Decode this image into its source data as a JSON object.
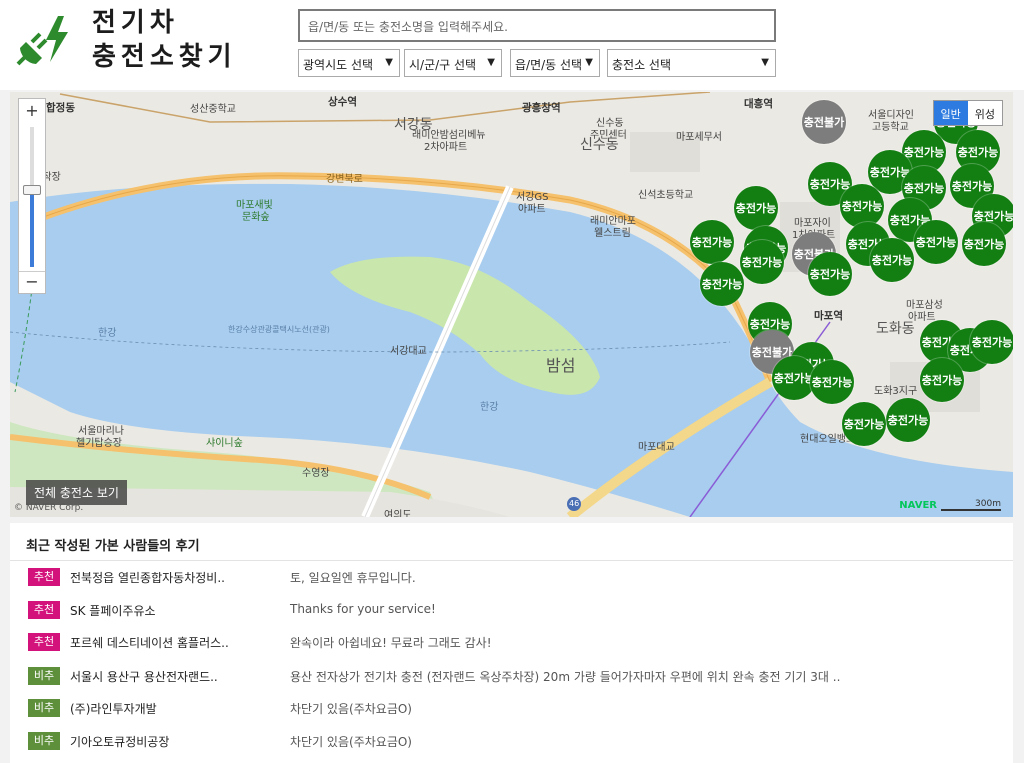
{
  "header": {
    "title_line1": "전기차",
    "title_line2": "충전소찾기",
    "search_placeholder": "읍/면/동 또는 충전소명을 입력해주세요.",
    "selects": [
      "광역시도 선택",
      "시/군/구 선택",
      "읍/면/동 선택",
      "충전소 선택"
    ],
    "select_arrow": "▼"
  },
  "map": {
    "zoom_in": "+",
    "zoom_out": "−",
    "maptype_normal": "일반",
    "maptype_satellite": "위성",
    "all_stations_button": "전체 충전소 보기",
    "copyright": "© NAVER Corp.",
    "naver_logo": "NAVER",
    "scale": "300m",
    "marker_available": "충전가능",
    "marker_unavailable": "충전불가",
    "labels": {
      "hapjeong": "합정동",
      "sangsu": "상수역",
      "gwangheung": "광흥창역",
      "daeheung": "대흥역",
      "seogang": "서강동",
      "sinsu": "신수동",
      "mapo_tax": "마포세무서",
      "seongsan_school": "성산중학교",
      "raemian1": "래미안밤섬리베뉴",
      "raemian2": "2차아파트",
      "sinsu_center1": "신수동",
      "sinsu_center2": "주민센터",
      "seogang_gs1": "서강GS",
      "seogang_gs2": "아파트",
      "raemian_mapo1": "래미안마포",
      "raemian_mapo2": "웰스트림",
      "sinseok": "신석초등학교",
      "bongsan": "봉산작장",
      "mapo_saebit1": "마포새빛",
      "mapo_saebit2": "문화숲",
      "gangbyeon": "강변북로",
      "hangang": "한강",
      "hangang2": "한강",
      "cruise": "한강수상관광콜택시노선(관광)",
      "seogang_bridge": "서강대교",
      "bamseom": "밤섬",
      "mapo_bridge": "마포대교",
      "mapo_stn": "마포역",
      "dohwa": "도화동",
      "mapo_samsung1": "마포삼성",
      "mapo_samsung2": "아파트",
      "mapo_xi1": "마포자이",
      "mapo_xi2": "1차아파트",
      "dohwa3": "도화3지구",
      "hyundai_oil": "현대오일뱅크",
      "seoul_design1": "서울디자인",
      "seoul_design2": "고등학교",
      "seoul_marina1": "서울마리나",
      "seoul_marina2": "헬기탑승장",
      "sailing": "샤이니숲",
      "pool": "수영장",
      "yeouido": "여의도",
      "num46": "46"
    }
  },
  "reviews": {
    "title": "최근 작성된 가본 사람들의 후기",
    "items": [
      {
        "badge": "추천",
        "type": "rec",
        "name": "전북정읍 열린종합자동차정비..",
        "text": "토, 일요일엔 휴무입니다."
      },
      {
        "badge": "추천",
        "type": "rec",
        "name": "SK 플페이주유소",
        "text": "Thanks for your service!"
      },
      {
        "badge": "추천",
        "type": "rec",
        "name": "포르쉐 데스티네이션 홈플러스..",
        "text": "완속이라 아쉽네요! 무료라 그래도 감사!"
      },
      {
        "badge": "비추",
        "type": "non",
        "name": "서울시 용산구 용산전자랜드..",
        "text": "용산 전자상가 전기차 충전 (전자랜드 옥상주차장) 20m 가량 들어가자마자 우편에 위치 완속 충전 기기 3대 .."
      },
      {
        "badge": "비추",
        "type": "non",
        "name": "(주)라인투자개발",
        "text": "차단기 있음(주차요금O)"
      },
      {
        "badge": "비추",
        "type": "non",
        "name": "기아오토큐정비공장",
        "text": "차단기 있음(주차요금O)"
      }
    ]
  },
  "colors": {
    "available": "#137f13",
    "unavailable": "#7d7d7d",
    "recommend": "#d4127b",
    "not_recommend": "#5e8f3b",
    "river": "#a8cdee",
    "island": "#c9e6ad"
  }
}
